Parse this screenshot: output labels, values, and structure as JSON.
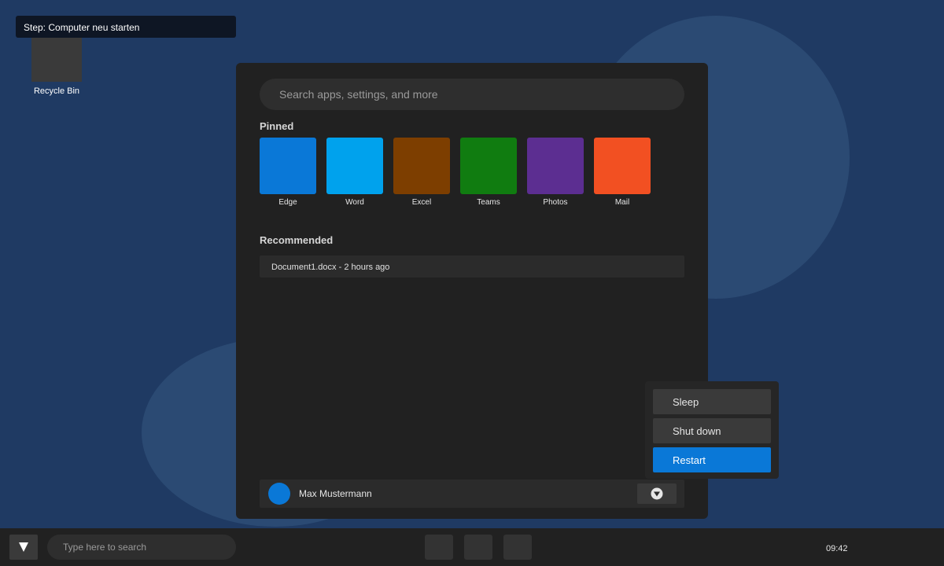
{
  "step_banner": {
    "text": "Step: Computer neu starten"
  },
  "desktop": {
    "icons": [
      {
        "label": "Recycle Bin",
        "icon": "recycle-bin-icon"
      }
    ]
  },
  "start_menu": {
    "search": {
      "placeholder": "Search apps, settings, and more"
    },
    "pinned": {
      "title": "Pinned",
      "apps": [
        {
          "label": "Edge",
          "color": "#0a78d7"
        },
        {
          "label": "Word",
          "color": "#00a2ed"
        },
        {
          "label": "Excel",
          "color": "#7d3e00"
        },
        {
          "label": "Teams",
          "color": "#107c10"
        },
        {
          "label": "Photos",
          "color": "#5c2e91"
        },
        {
          "label": "Mail",
          "color": "#f25022"
        }
      ]
    },
    "recommended": {
      "title": "Recommended",
      "items": [
        {
          "text": "Document1.docx - 2 hours ago"
        }
      ]
    },
    "user": {
      "name": "Max Mustermann"
    }
  },
  "power_menu": {
    "options": [
      {
        "label": "Sleep"
      },
      {
        "label": "Shut down"
      },
      {
        "label": "Restart",
        "highlighted": true
      }
    ]
  },
  "taskbar": {
    "search_placeholder": "Type here to search",
    "clock": "09:42"
  },
  "colors": {
    "desktop_bg": "#1f3a63",
    "panel_bg": "#212121",
    "accent": "#0a78d7"
  }
}
